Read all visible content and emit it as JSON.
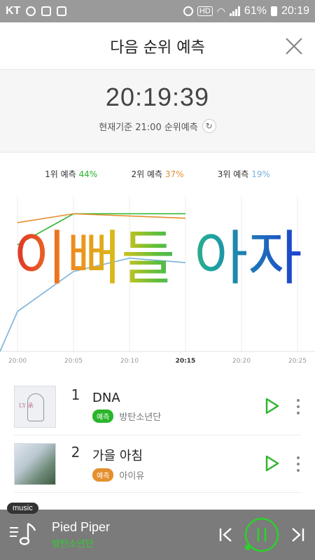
{
  "status_bar": {
    "carrier": "KT",
    "battery": "61%",
    "time": "20:19"
  },
  "header": {
    "title": "다음 순위 예측"
  },
  "timer": {
    "clock": "20:19:39",
    "subtitle": "현재기준 21:00 순위예측"
  },
  "legend": [
    {
      "label": "1위 예측",
      "pct": "44%",
      "color": "#2ab52a"
    },
    {
      "label": "2위 예측",
      "pct": "37%",
      "color": "#e48f2e"
    },
    {
      "label": "3위 예측",
      "pct": "19%",
      "color": "#7ab3dc"
    }
  ],
  "overlay_text": "이뻐들 아자",
  "chart_data": {
    "type": "line",
    "x": [
      "20:00",
      "20:05",
      "20:10",
      "20:15",
      "20:20",
      "20:25"
    ],
    "series": [
      {
        "name": "1위 예측",
        "color": "#2ab52a",
        "values": [
          48,
          62,
          62,
          62,
          null,
          null
        ]
      },
      {
        "name": "2위 예측",
        "color": "#e48f2e",
        "values": [
          58,
          62,
          61,
          60,
          null,
          null
        ]
      },
      {
        "name": "3위 예측",
        "color": "#7ab3dc",
        "values": [
          18,
          36,
          42,
          40,
          null,
          null
        ]
      }
    ],
    "ylim": [
      0,
      70
    ],
    "grid": true,
    "current_x": "20:15"
  },
  "songs": [
    {
      "rank": "1",
      "title": "DNA",
      "artist": "방탄소년단",
      "badge": "예측",
      "badge_color": "green"
    },
    {
      "rank": "2",
      "title": "가을 아침",
      "artist": "아이유",
      "badge": "예측",
      "badge_color": "orange"
    }
  ],
  "player": {
    "tag": "music",
    "title": "Pied Piper",
    "artist": "방탄소년단"
  }
}
